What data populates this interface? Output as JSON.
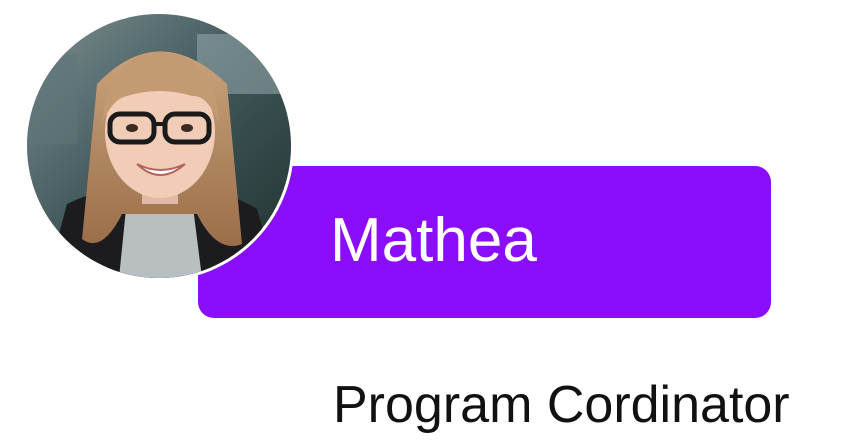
{
  "profile": {
    "name": "Mathea",
    "role": "Program Cordinator"
  },
  "colors": {
    "card_accent": "#8a0dfb",
    "name_text": "#ffffff",
    "role_text": "#111111"
  },
  "avatar": {
    "icon": "profile-photo"
  }
}
